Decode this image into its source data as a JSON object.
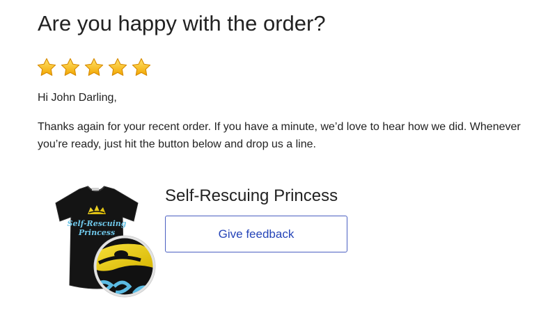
{
  "email": {
    "heading": "Are you happy with the order?",
    "rating": {
      "icon": "star-icon",
      "filled": 5,
      "max": 5,
      "color": "#f5b800"
    },
    "greeting": "Hi John Darling,",
    "message": "Thanks again for your recent order. If you have a minute, we’d love to hear how we did. Whenever you’re ready, just hit the button below and drop us a line."
  },
  "product": {
    "image_icon": "tshirt-product-image",
    "image_text_line1": "Self-Rescuing",
    "image_text_line2": "Princess",
    "name": "Self-Rescuing Princess",
    "feedback_label": "Give feedback"
  },
  "colors": {
    "button_border": "#4a5fc1",
    "button_text": "#2544b8",
    "text": "#222222"
  }
}
